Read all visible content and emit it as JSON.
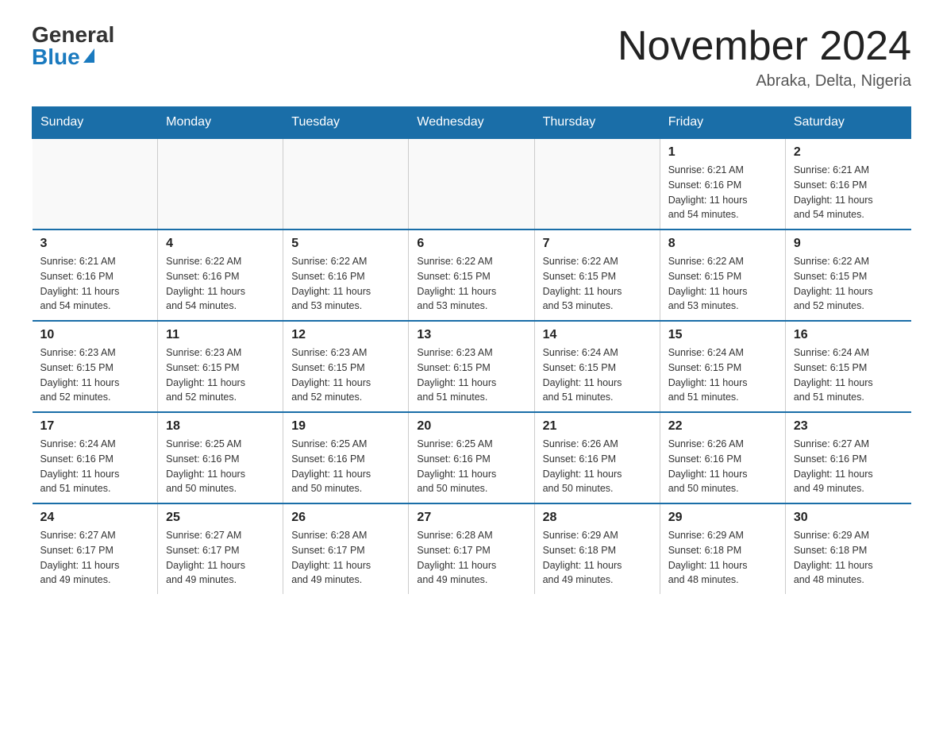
{
  "header": {
    "logo_general": "General",
    "logo_blue": "Blue",
    "month_title": "November 2024",
    "location": "Abraka, Delta, Nigeria"
  },
  "days_of_week": [
    "Sunday",
    "Monday",
    "Tuesday",
    "Wednesday",
    "Thursday",
    "Friday",
    "Saturday"
  ],
  "weeks": [
    [
      {
        "day": "",
        "info": ""
      },
      {
        "day": "",
        "info": ""
      },
      {
        "day": "",
        "info": ""
      },
      {
        "day": "",
        "info": ""
      },
      {
        "day": "",
        "info": ""
      },
      {
        "day": "1",
        "info": "Sunrise: 6:21 AM\nSunset: 6:16 PM\nDaylight: 11 hours\nand 54 minutes."
      },
      {
        "day": "2",
        "info": "Sunrise: 6:21 AM\nSunset: 6:16 PM\nDaylight: 11 hours\nand 54 minutes."
      }
    ],
    [
      {
        "day": "3",
        "info": "Sunrise: 6:21 AM\nSunset: 6:16 PM\nDaylight: 11 hours\nand 54 minutes."
      },
      {
        "day": "4",
        "info": "Sunrise: 6:22 AM\nSunset: 6:16 PM\nDaylight: 11 hours\nand 54 minutes."
      },
      {
        "day": "5",
        "info": "Sunrise: 6:22 AM\nSunset: 6:16 PM\nDaylight: 11 hours\nand 53 minutes."
      },
      {
        "day": "6",
        "info": "Sunrise: 6:22 AM\nSunset: 6:15 PM\nDaylight: 11 hours\nand 53 minutes."
      },
      {
        "day": "7",
        "info": "Sunrise: 6:22 AM\nSunset: 6:15 PM\nDaylight: 11 hours\nand 53 minutes."
      },
      {
        "day": "8",
        "info": "Sunrise: 6:22 AM\nSunset: 6:15 PM\nDaylight: 11 hours\nand 53 minutes."
      },
      {
        "day": "9",
        "info": "Sunrise: 6:22 AM\nSunset: 6:15 PM\nDaylight: 11 hours\nand 52 minutes."
      }
    ],
    [
      {
        "day": "10",
        "info": "Sunrise: 6:23 AM\nSunset: 6:15 PM\nDaylight: 11 hours\nand 52 minutes."
      },
      {
        "day": "11",
        "info": "Sunrise: 6:23 AM\nSunset: 6:15 PM\nDaylight: 11 hours\nand 52 minutes."
      },
      {
        "day": "12",
        "info": "Sunrise: 6:23 AM\nSunset: 6:15 PM\nDaylight: 11 hours\nand 52 minutes."
      },
      {
        "day": "13",
        "info": "Sunrise: 6:23 AM\nSunset: 6:15 PM\nDaylight: 11 hours\nand 51 minutes."
      },
      {
        "day": "14",
        "info": "Sunrise: 6:24 AM\nSunset: 6:15 PM\nDaylight: 11 hours\nand 51 minutes."
      },
      {
        "day": "15",
        "info": "Sunrise: 6:24 AM\nSunset: 6:15 PM\nDaylight: 11 hours\nand 51 minutes."
      },
      {
        "day": "16",
        "info": "Sunrise: 6:24 AM\nSunset: 6:15 PM\nDaylight: 11 hours\nand 51 minutes."
      }
    ],
    [
      {
        "day": "17",
        "info": "Sunrise: 6:24 AM\nSunset: 6:16 PM\nDaylight: 11 hours\nand 51 minutes."
      },
      {
        "day": "18",
        "info": "Sunrise: 6:25 AM\nSunset: 6:16 PM\nDaylight: 11 hours\nand 50 minutes."
      },
      {
        "day": "19",
        "info": "Sunrise: 6:25 AM\nSunset: 6:16 PM\nDaylight: 11 hours\nand 50 minutes."
      },
      {
        "day": "20",
        "info": "Sunrise: 6:25 AM\nSunset: 6:16 PM\nDaylight: 11 hours\nand 50 minutes."
      },
      {
        "day": "21",
        "info": "Sunrise: 6:26 AM\nSunset: 6:16 PM\nDaylight: 11 hours\nand 50 minutes."
      },
      {
        "day": "22",
        "info": "Sunrise: 6:26 AM\nSunset: 6:16 PM\nDaylight: 11 hours\nand 50 minutes."
      },
      {
        "day": "23",
        "info": "Sunrise: 6:27 AM\nSunset: 6:16 PM\nDaylight: 11 hours\nand 49 minutes."
      }
    ],
    [
      {
        "day": "24",
        "info": "Sunrise: 6:27 AM\nSunset: 6:17 PM\nDaylight: 11 hours\nand 49 minutes."
      },
      {
        "day": "25",
        "info": "Sunrise: 6:27 AM\nSunset: 6:17 PM\nDaylight: 11 hours\nand 49 minutes."
      },
      {
        "day": "26",
        "info": "Sunrise: 6:28 AM\nSunset: 6:17 PM\nDaylight: 11 hours\nand 49 minutes."
      },
      {
        "day": "27",
        "info": "Sunrise: 6:28 AM\nSunset: 6:17 PM\nDaylight: 11 hours\nand 49 minutes."
      },
      {
        "day": "28",
        "info": "Sunrise: 6:29 AM\nSunset: 6:18 PM\nDaylight: 11 hours\nand 49 minutes."
      },
      {
        "day": "29",
        "info": "Sunrise: 6:29 AM\nSunset: 6:18 PM\nDaylight: 11 hours\nand 48 minutes."
      },
      {
        "day": "30",
        "info": "Sunrise: 6:29 AM\nSunset: 6:18 PM\nDaylight: 11 hours\nand 48 minutes."
      }
    ]
  ]
}
